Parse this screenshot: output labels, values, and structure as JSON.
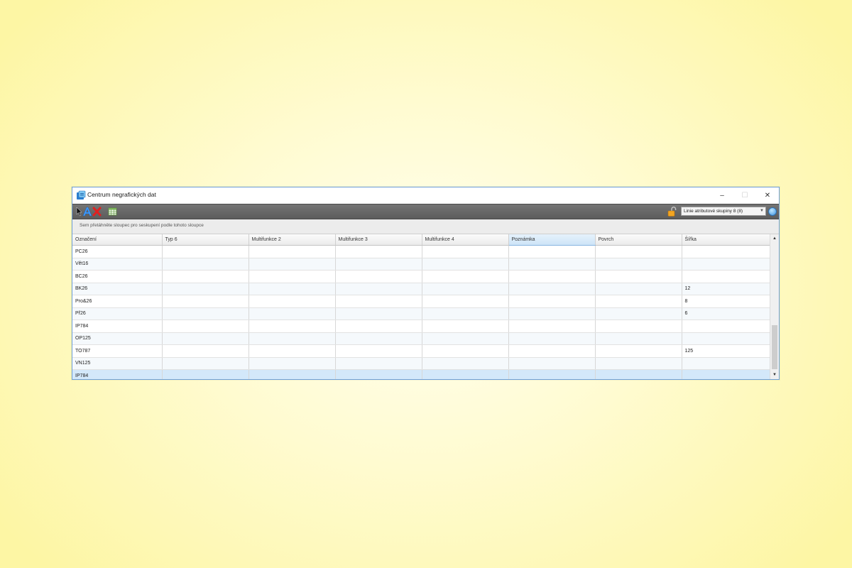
{
  "window": {
    "title": "Centrum negrafických dat"
  },
  "window_controls": {
    "minimize": "–",
    "maximize": "☐",
    "close": "✕"
  },
  "toolbar": {
    "icons": [
      "select-arrow-icon",
      "attribute-a-icon",
      "delete-x-icon",
      "table-icon"
    ],
    "layer_select_value": "Linie atributové skupiny 8 (8)",
    "lock_icon": "lock-open-icon",
    "help_icon": "help-icon"
  },
  "group_panel": {
    "hint": "Sem přetáhněte sloupec pro seskupení podle tohoto sloupce"
  },
  "grid": {
    "columns": [
      "Označení",
      "Typ 6",
      "Multifunkce 2",
      "Multifunkce 3",
      "Multifunkce 4",
      "Poznámka",
      "Povrch",
      "Šířka"
    ],
    "active_column": "Poznámka",
    "rows": [
      [
        "PC26",
        "",
        "",
        "",
        "",
        "",
        "",
        ""
      ],
      [
        "Vět16",
        "",
        "",
        "",
        "",
        "",
        "",
        ""
      ],
      [
        "BC26",
        "",
        "",
        "",
        "",
        "",
        "",
        ""
      ],
      [
        "BK26",
        "",
        "",
        "",
        "",
        "",
        "",
        "12"
      ],
      [
        "Pro&26",
        "",
        "",
        "",
        "",
        "",
        "",
        "8"
      ],
      [
        "Př26",
        "",
        "",
        "",
        "",
        "",
        "",
        "6"
      ],
      [
        "IP784",
        "",
        "",
        "",
        "",
        "",
        "",
        ""
      ],
      [
        "OP125",
        "",
        "",
        "",
        "",
        "",
        "",
        ""
      ],
      [
        "TO787",
        "",
        "",
        "",
        "",
        "",
        "",
        "125"
      ],
      [
        "VN125",
        "",
        "",
        "",
        "",
        "",
        "",
        ""
      ],
      [
        "IP784",
        "",
        "",
        "",
        "",
        "",
        "",
        ""
      ]
    ],
    "selected_row": 10
  },
  "colors": {
    "toolbar_bg": "#666666",
    "selection": "#d3e8fa",
    "window_border": "#6e9fd6"
  }
}
